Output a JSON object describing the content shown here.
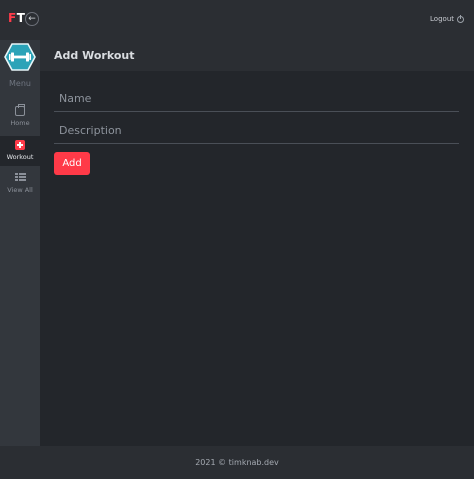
{
  "brand": {
    "letter_f": "F",
    "letter_t": "T"
  },
  "header": {
    "logout_label": "Logout"
  },
  "sidebar": {
    "menu_title": "Menu",
    "items": [
      {
        "label": "Home",
        "icon": "home-icon",
        "active": false
      },
      {
        "label": "Workout",
        "icon": "plus-square-icon",
        "active": true
      },
      {
        "label": "View All",
        "icon": "list-icon",
        "active": false
      }
    ]
  },
  "page": {
    "title": "Add Workout"
  },
  "form": {
    "name_placeholder": "Name",
    "name_value": "",
    "description_placeholder": "Description",
    "description_value": "",
    "submit_label": "Add"
  },
  "footer": {
    "text": "2021 © timknab.dev"
  },
  "colors": {
    "accent": "#ff3b4a",
    "logo_hex": "#2ba3b8",
    "background": "#23262b",
    "panel": "#2b2e33",
    "sidebar": "#33373d"
  }
}
